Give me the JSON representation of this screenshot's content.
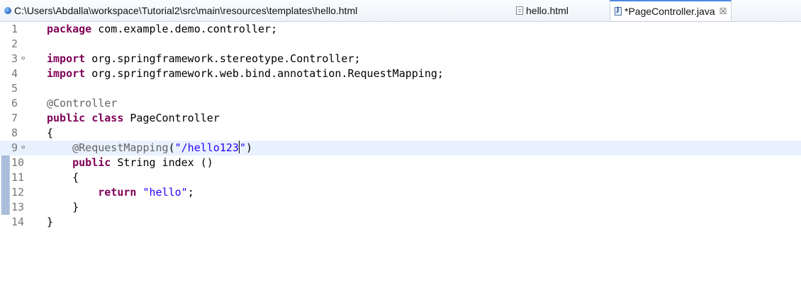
{
  "tabs": [
    {
      "label": "C:\\Users\\Abdalla\\workspace\\Tutorial2\\src\\main\\resources\\templates\\hello.html",
      "icon": "globe-icon"
    },
    {
      "label": "hello.html",
      "icon": "html-file-icon"
    },
    {
      "label": "*PageController.java",
      "icon": "java-file-icon",
      "close": "☒",
      "active": true
    }
  ],
  "editor": {
    "current_line": 9,
    "lines": [
      {
        "num": "1",
        "indent": "",
        "parts": [
          [
            "kw",
            "package"
          ],
          [
            "",
            "com.example.demo.controller;"
          ]
        ]
      },
      {
        "num": "2",
        "indent": "",
        "parts": []
      },
      {
        "num": "3",
        "indent": "",
        "fold": "⊖",
        "parts": [
          [
            "kw",
            "import"
          ],
          [
            "",
            "org.springframework.stereotype.Controller;"
          ]
        ]
      },
      {
        "num": "4",
        "indent": "",
        "parts": [
          [
            "kw",
            "import"
          ],
          [
            "",
            "org.springframework.web.bind.annotation.RequestMapping;"
          ]
        ]
      },
      {
        "num": "5",
        "indent": "",
        "parts": []
      },
      {
        "num": "6",
        "indent": "",
        "parts": [
          [
            "ann",
            "@Controller"
          ]
        ]
      },
      {
        "num": "7",
        "indent": "",
        "parts": [
          [
            "kw",
            "public"
          ],
          [
            "kw",
            "class"
          ],
          [
            "",
            "PageController"
          ]
        ]
      },
      {
        "num": "8",
        "indent": "",
        "parts": [
          [
            "",
            "{"
          ]
        ]
      },
      {
        "num": "9",
        "indent": "    ",
        "fold": "⊖",
        "parts": [
          [
            "ann",
            "@RequestMapping"
          ],
          [
            "",
            "("
          ],
          [
            "str",
            "\"/hello123"
          ],
          [
            "caret",
            ""
          ],
          [
            "str",
            "\""
          ],
          [
            "",
            ")"
          ]
        ]
      },
      {
        "num": "10",
        "indent": "    ",
        "parts": [
          [
            "kw",
            "public"
          ],
          [
            "",
            "String index ()"
          ]
        ]
      },
      {
        "num": "11",
        "indent": "    ",
        "parts": [
          [
            "",
            "{"
          ]
        ]
      },
      {
        "num": "12",
        "indent": "        ",
        "parts": [
          [
            "kw",
            "return"
          ],
          [
            "str",
            "\"hello\""
          ],
          [
            "",
            ";"
          ]
        ]
      },
      {
        "num": "13",
        "indent": "    ",
        "parts": [
          [
            "",
            "}"
          ]
        ]
      },
      {
        "num": "14",
        "indent": "",
        "parts": [
          [
            "",
            "}"
          ]
        ]
      }
    ]
  }
}
